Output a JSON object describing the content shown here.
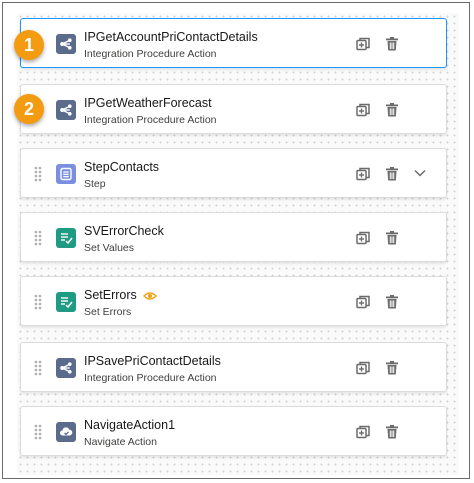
{
  "steps": [
    {
      "title": "IPGetAccountPriContactDetails",
      "subtitle": "Integration Procedure Action",
      "icon": "integration-procedure-icon",
      "icon_color": "#5a6b8c",
      "selected": true,
      "has_drag_handle": false,
      "has_expand": false,
      "has_preview": false
    },
    {
      "title": "IPGetWeatherForecast",
      "subtitle": "Integration Procedure Action",
      "icon": "integration-procedure-icon",
      "icon_color": "#5a6b8c",
      "selected": false,
      "has_drag_handle": false,
      "has_expand": false,
      "has_preview": false
    },
    {
      "title": "StepContacts",
      "subtitle": "Step",
      "icon": "step-icon",
      "icon_color": "#7b8fe0",
      "selected": false,
      "has_drag_handle": true,
      "has_expand": true,
      "has_preview": false
    },
    {
      "title": "SVErrorCheck",
      "subtitle": "Set Values",
      "icon": "set-values-icon",
      "icon_color": "#1f9b83",
      "selected": false,
      "has_drag_handle": true,
      "has_expand": false,
      "has_preview": false
    },
    {
      "title": "SetErrors",
      "subtitle": "Set Errors",
      "icon": "set-values-icon",
      "icon_color": "#1f9b83",
      "selected": false,
      "has_drag_handle": true,
      "has_expand": false,
      "has_preview": true
    },
    {
      "title": "IPSavePriContactDetails",
      "subtitle": "Integration Procedure Action",
      "icon": "integration-procedure-icon",
      "icon_color": "#5a6b8c",
      "selected": false,
      "has_drag_handle": true,
      "has_expand": false,
      "has_preview": false
    },
    {
      "title": "NavigateAction1",
      "subtitle": "Navigate Action",
      "icon": "navigate-action-icon",
      "icon_color": "#5a6b8c",
      "selected": false,
      "has_drag_handle": true,
      "has_expand": false,
      "has_preview": false
    }
  ],
  "callouts": [
    "1",
    "2"
  ],
  "colors": {
    "callout": "#f39c12",
    "selected_border": "#1b96ff",
    "action_icon": "#6b6b6b",
    "preview_icon": "#f39c12"
  }
}
